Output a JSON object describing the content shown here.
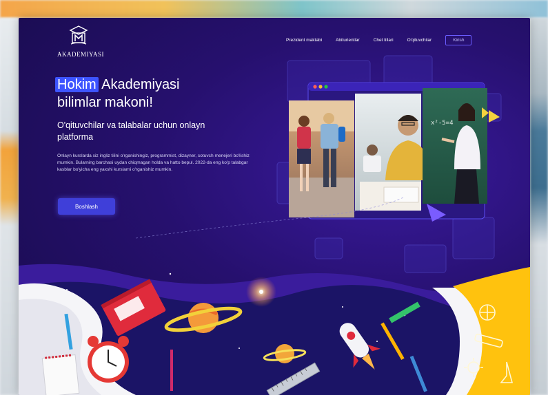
{
  "brand": {
    "name": "AKADEMIYASI",
    "logo_icon": "academy-book-logo-icon"
  },
  "nav": {
    "items": [
      {
        "label": "Prezident maktabi"
      },
      {
        "label": "Abiturientlar"
      },
      {
        "label": "Chet tillari"
      },
      {
        "label": "O'qituvchilar"
      }
    ],
    "login_label": "Kirish"
  },
  "hero": {
    "title_highlight": "Hokim",
    "title_rest_line1": "Akademiyasi",
    "title_line2": "bilimlar makoni!",
    "subtitle": "O'qituvchilar va talabalar uchun onlayn platforma",
    "description": "Onlayn kurslarda siz ingliz tilini o'rganishingiz, programmist, dizayner, sotuvch menejeri bo'lishiz mumkin. Bularning barchasi uydan chiqmagan holda va hatto bepul. 2022-da eng ko'p talabgar kasblar bo'yicha eng yaxshi kurslarni o'rganishiz mumkin.",
    "cta_label": "Boshlash"
  },
  "colors": {
    "background": "#1f0d5e",
    "accent": "#3f3fd9",
    "highlight": "#3d54ff",
    "yellow": "#ffc20e"
  }
}
